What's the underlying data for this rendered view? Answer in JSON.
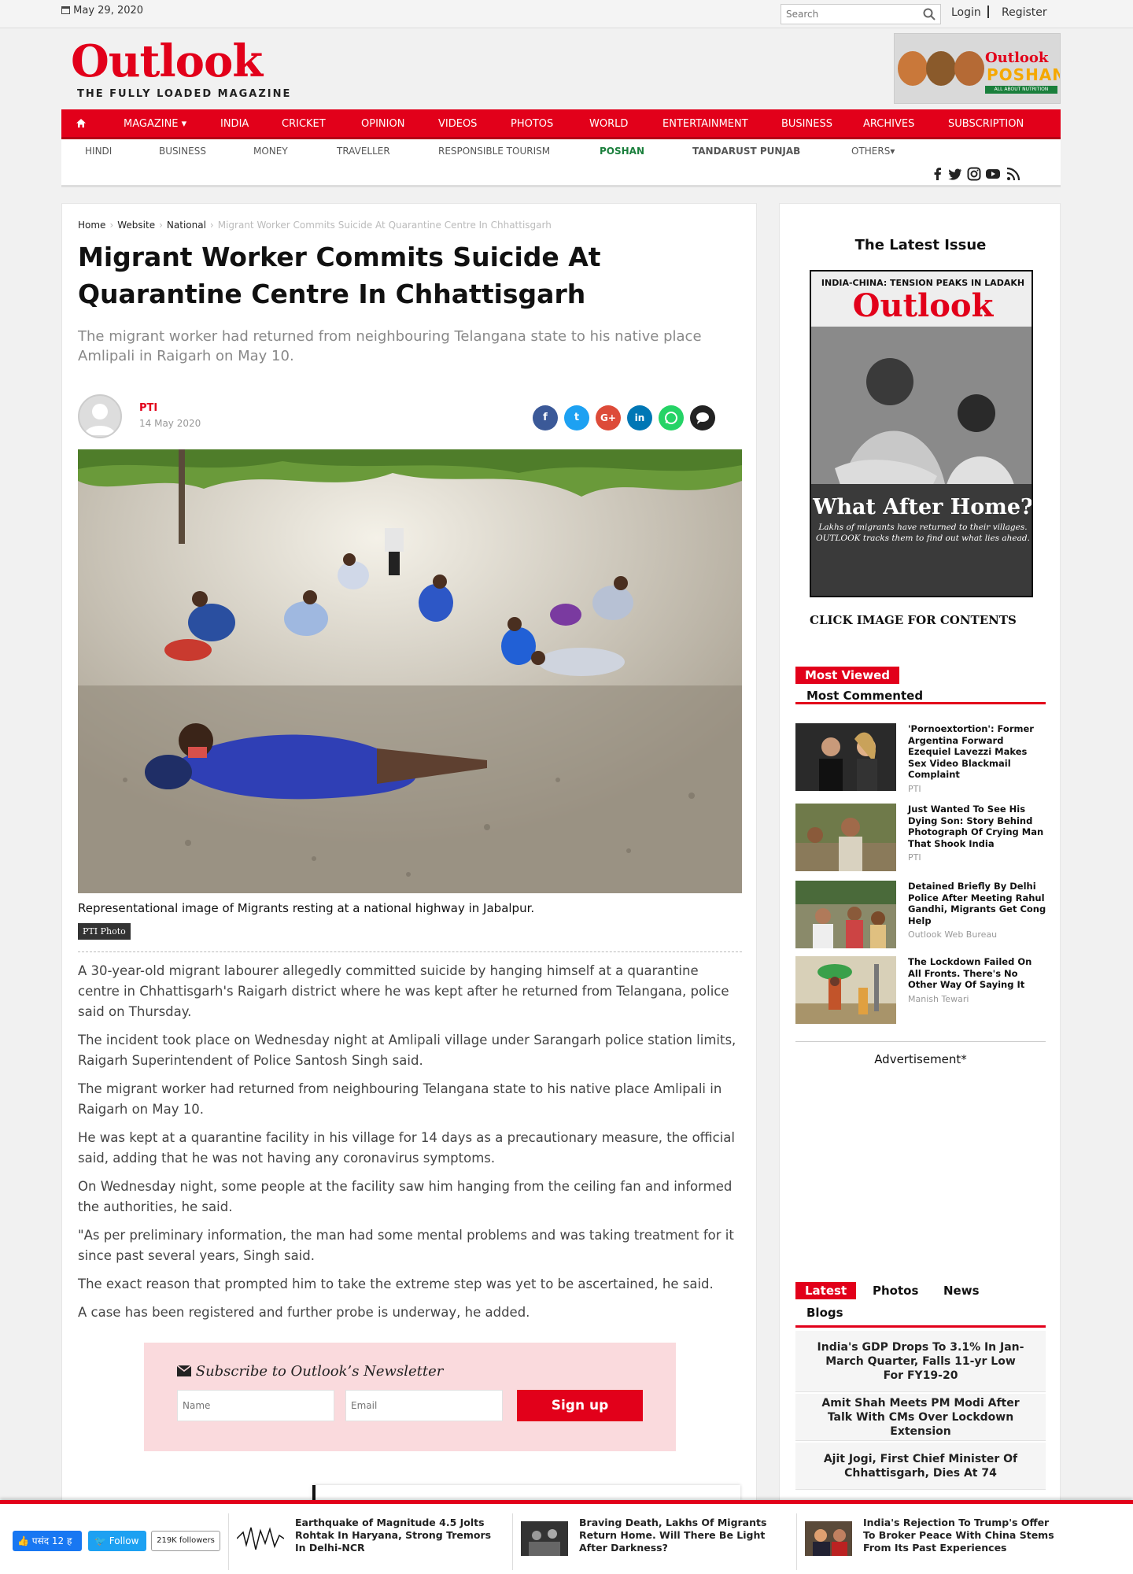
{
  "topbar": {
    "date": "May 29, 2020",
    "search_placeholder": "Search",
    "login": "Login",
    "register": "Register"
  },
  "brand": {
    "logo": "Outlook",
    "tagline": "THE FULLY LOADED MAGAZINE",
    "ad_brand": "Outlook",
    "ad_name": "POSHAN",
    "ad_sub": "ALL ABOUT NUTRITION"
  },
  "nav": {
    "items": [
      "MAGAZINE",
      "INDIA",
      "CRICKET",
      "OPINION",
      "VIDEOS",
      "PHOTOS",
      "WORLD",
      "ENTERTAINMENT",
      "BUSINESS",
      "ARCHIVES",
      "SUBSCRIPTION"
    ]
  },
  "subnav": {
    "items": [
      "HINDI",
      "BUSINESS",
      "MONEY",
      "TRAVELLER",
      "RESPONSIBLE TOURISM",
      "POSHAN",
      "TANDARUST PUNJAB",
      "OTHERS"
    ]
  },
  "breadcrumb": {
    "home": "Home",
    "website": "Website",
    "national": "National",
    "current": "Migrant Worker Commits Suicide At Quarantine Centre In Chhattisgarh"
  },
  "article": {
    "title": "Migrant Worker Commits Suicide At Quarantine Centre In Chhattisgarh",
    "summary": "The migrant worker had returned from neighbouring Telangana state to his native place Amlipali in Raigarh on May 10.",
    "author": "PTI",
    "date": "14 May 2020",
    "caption": "Representational image of Migrants resting at a national highway in Jabalpur.",
    "credit": "PTI Photo",
    "paragraphs": [
      "A 30-year-old migrant labourer allegedly committed suicide by hanging himself at a quarantine centre in Chhattisgarh's Raigarh district where he was kept after he returned from Telangana, police said on Thursday.",
      "The incident took place on Wednesday night at Amlipali village under Sarangarh police station limits, Raigarh Superintendent of Police Santosh Singh said.",
      "The migrant worker had returned from neighbouring Telangana state to his native place Amlipali in Raigarh on May 10.",
      "He was kept at a quarantine facility in his village for 14 days as a precautionary measure, the official said, adding that he was not having any coronavirus symptoms.",
      "On Wednesday night, some people at the facility saw him hanging from the ceiling fan and informed the authorities, he said.",
      "\"As per preliminary information, the man had some mental problems and was taking treatment for it since past several years, Singh said.",
      "The exact reason that prompted him to take the extreme step was yet to be ascertained, he said.",
      "A case has been registered and further probe is underway, he added."
    ]
  },
  "newsletter": {
    "title": "Subscribe to Outlook’s Newsletter",
    "name_placeholder": "Name",
    "email_placeholder": "Email",
    "button": "Sign up"
  },
  "sidebar": {
    "latest_issue": "The Latest Issue",
    "cover": {
      "top": "INDIA-CHINA: TENSION PEAKS IN LADAKH",
      "logo": "Outlook",
      "headline": "What After Home?",
      "sub1": "Lakhs of migrants have returned to their villages.",
      "sub2": "OUTLOOK tracks them to find out what lies ahead."
    },
    "click": "CLICK IMAGE FOR CONTENTS",
    "tabs": [
      "Most Viewed",
      "Most Commented"
    ],
    "most_viewed": [
      {
        "title": "'Pornoextortion': Former Argentina Forward Ezequiel Lavezzi Makes Sex Video Blackmail Complaint",
        "source": "PTI"
      },
      {
        "title": "Just Wanted To See His Dying Son: Story Behind Photograph Of Crying Man That Shook India",
        "source": "PTI"
      },
      {
        "title": "Detained Briefly By Delhi Police After Meeting Rahul Gandhi, Migrants Get Cong Help",
        "source": "Outlook Web Bureau"
      },
      {
        "title": "The Lockdown Failed On All Fronts. There's No Other Way Of Saying It",
        "source": "Manish Tewari"
      }
    ],
    "advertisement": "Advertisement*",
    "latest_tabs": [
      "Latest",
      "Photos",
      "News",
      "Blogs"
    ],
    "latest": [
      "India's GDP Drops To 3.1% In Jan-March Quarter, Falls 11-yr Low For FY19-20",
      "Amit Shah Meets PM Modi After Talk With CMs Over Lockdown Extension",
      "Ajit Jogi, First Chief Minister Of Chhattisgarh, Dies At 74"
    ]
  },
  "footer": {
    "fb_like": "पसंद 12 ह",
    "tw_follow": "Follow",
    "tw_count": "219K followers",
    "stories": [
      "Earthquake of Magnitude 4.5 Jolts Rohtak In Haryana, Strong Tremors In Delhi-NCR",
      "Braving Death, Lakhs Of Migrants Return Home. Will There Be Light After Darkness?",
      "India's Rejection To Trump's Offer To Broker Peace With China Stems From Its Past Experiences"
    ]
  },
  "colors": {
    "brand_red": "#e2001a",
    "poshan_green": "#1a7f3c"
  }
}
